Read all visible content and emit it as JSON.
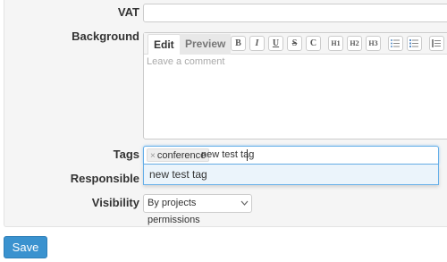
{
  "form": {
    "vat_label": "VAT",
    "background_label": "Background",
    "tags_label": "Tags",
    "responsible_label": "Responsible",
    "visibility_label": "Visibility"
  },
  "editor": {
    "tab_edit": "Edit",
    "tab_preview": "Preview",
    "toolbar": [
      "B",
      "I",
      "U",
      "S",
      "C",
      "H1",
      "H2",
      "H3",
      "ul",
      "ol",
      "quote"
    ],
    "placeholder": "Leave a comment"
  },
  "tags": {
    "chips": [
      "conference"
    ],
    "typed": "new test tag",
    "suggestion": "new test tag"
  },
  "visibility": {
    "selected": "By projects permissions"
  },
  "actions": {
    "save_label": "Save"
  },
  "colors": {
    "primary_button": "#3a92cf",
    "focus_border": "#66afe9",
    "panel_bg": "#f5f5f5"
  }
}
